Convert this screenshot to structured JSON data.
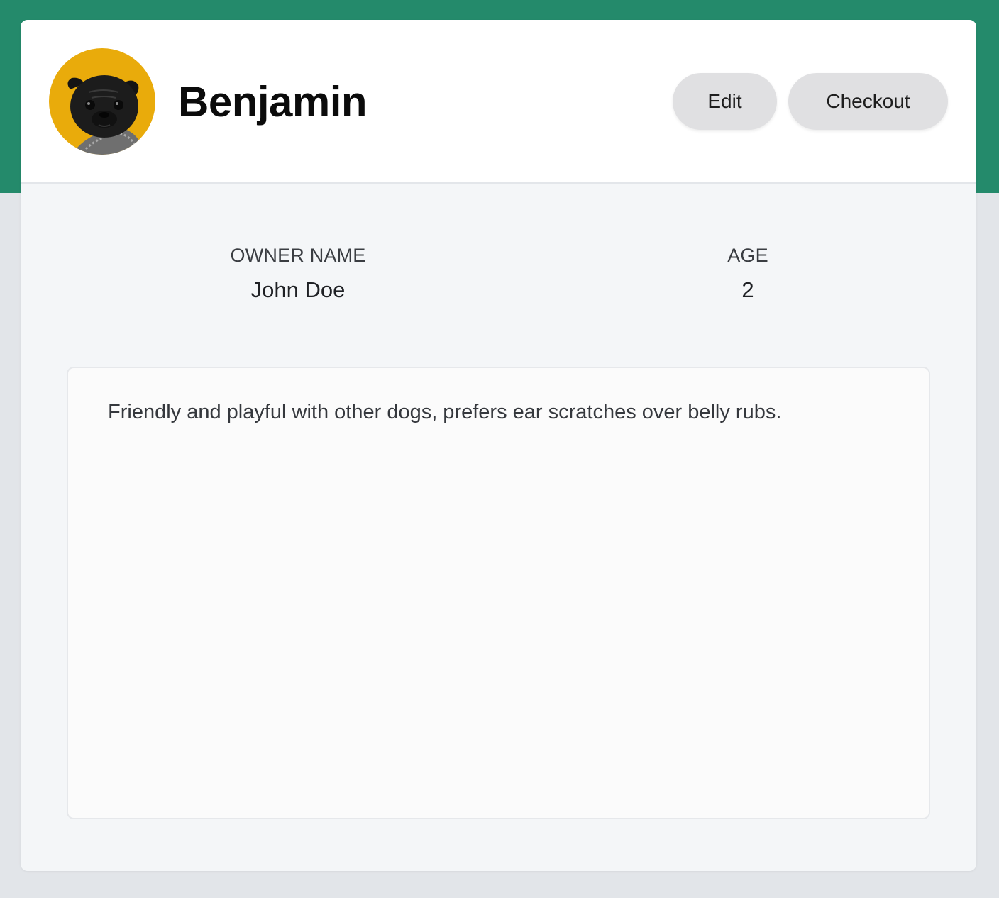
{
  "pet": {
    "name": "Benjamin",
    "avatar_icon": "pug-photo",
    "avatar_bg_color": "#e9ab0b"
  },
  "actions": {
    "edit_label": "Edit",
    "checkout_label": "Checkout"
  },
  "details": {
    "owner_label": "OWNER NAME",
    "owner_value": "John Doe",
    "age_label": "AGE",
    "age_value": "2"
  },
  "notes": {
    "text": "Friendly and playful with other dogs, prefers ear scratches over belly rubs."
  },
  "theme": {
    "accent_color": "#248a6b",
    "page_bg": "#e2e5e9",
    "card_bg": "#f4f6f8"
  }
}
